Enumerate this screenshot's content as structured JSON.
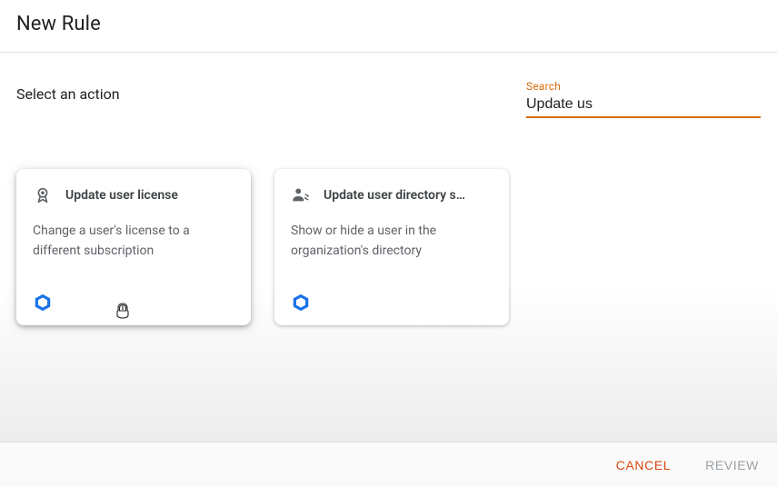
{
  "header": {
    "title": "New Rule"
  },
  "section": {
    "title": "Select an action"
  },
  "search": {
    "label": "Search",
    "value": "Update us"
  },
  "cards": [
    {
      "icon": "badge-ribbon-icon",
      "title": "Update user license",
      "description": "Change a user's license to a different subscription"
    },
    {
      "icon": "user-swap-icon",
      "title": "Update user directory s…",
      "description": "Show or hide a user in the organization's directory"
    }
  ],
  "footer": {
    "cancel": "CANCEL",
    "review": "REVIEW"
  },
  "colors": {
    "accent": "#d96b0f",
    "badge": "#1a73e8"
  }
}
